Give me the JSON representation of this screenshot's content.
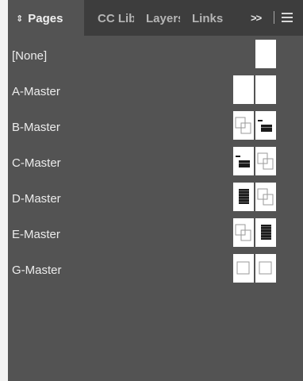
{
  "tabs": [
    {
      "label": "Pages",
      "active": true
    },
    {
      "label": "CC Libraries"
    },
    {
      "label": "Layers"
    },
    {
      "label": "Links"
    }
  ],
  "tab_overflow": "»",
  "masters": [
    {
      "label": "[None]",
      "thumbs": [
        "blank"
      ]
    },
    {
      "label": "A-Master",
      "thumbs": [
        "blank",
        "blank"
      ]
    },
    {
      "label": "B-Master",
      "thumbs": [
        "frames",
        "text-block"
      ]
    },
    {
      "label": "C-Master",
      "thumbs": [
        "text-block",
        "frames"
      ]
    },
    {
      "label": "D-Master",
      "thumbs": [
        "text-dense",
        "frames"
      ]
    },
    {
      "label": "E-Master",
      "thumbs": [
        "frames",
        "text-dense"
      ]
    },
    {
      "label": "G-Master",
      "thumbs": [
        "frame-single",
        "frame-single"
      ]
    }
  ],
  "colors": {
    "panel_bg": "#535353",
    "tabbar_bg": "#3d3d3d",
    "page_bg": "#ffffff"
  }
}
